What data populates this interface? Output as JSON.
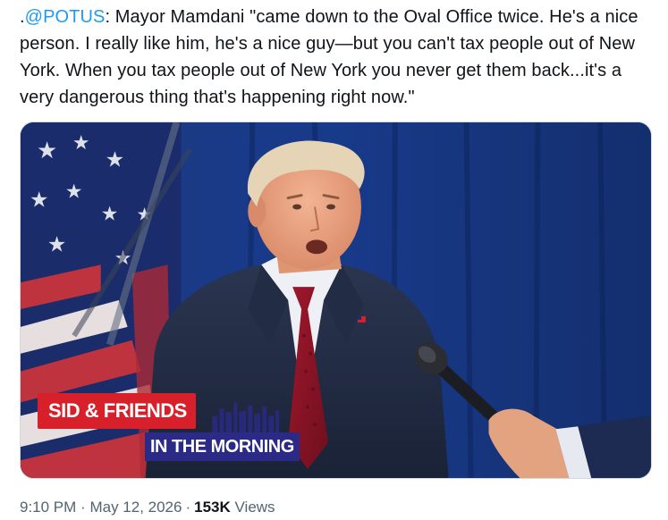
{
  "tweet": {
    "lead": ".",
    "mention": "@POTUS",
    "body": ": Mayor Mamdani \"came down to the Oval Office twice. He's a nice person. I really like him, he's a nice guy—but you can't tax people out of New York. When you tax people out of New York you never get them back...it's a very dangerous thing that's happening right now.\""
  },
  "media": {
    "brand_top": "SID & FRIENDS",
    "brand_bottom": "IN THE MORNING"
  },
  "meta": {
    "time": "9:10 PM",
    "separator": "·",
    "date": "May 12, 2026",
    "views_count": "153K",
    "views_label": "Views"
  },
  "colors": {
    "mention": "#1d9bf0",
    "text": "#0f1419",
    "muted": "#536471",
    "brand_red": "#d8202a",
    "brand_blue": "#2b2a87"
  }
}
